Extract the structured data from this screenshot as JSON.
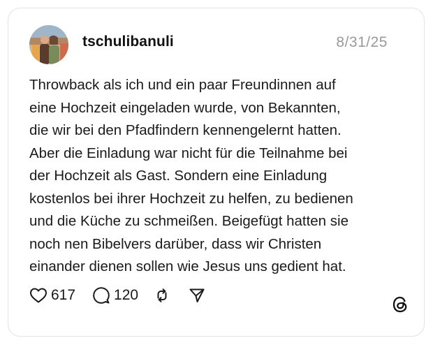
{
  "post": {
    "username": "tschulibanuli",
    "date": "8/31/25",
    "text_lines": [
      "Throwback als ich und ein paar Freundinnen auf",
      "eine Hochzeit eingeladen wurde, von Bekannten,",
      "die wir bei den Pfadfindern kennengelernt hatten.",
      "Aber die Einladung war nicht für die Teilnahme bei",
      "der Hochzeit als Gast. Sondern eine Einladung",
      "kostenlos bei ihrer Hochzeit zu helfen, zu bedienen",
      "und die Küche zu schmeißen. Beigefügt hatten sie",
      "noch nen Bibelvers darüber, dass wir Christen",
      "einander dienen sollen wie Jesus uns gedient hat."
    ]
  },
  "actions": {
    "like_count": "617",
    "reply_count": "120",
    "icons": [
      "heart-icon",
      "comment-icon",
      "repost-icon",
      "share-icon"
    ]
  },
  "brand": {
    "logo": "threads-logo-icon"
  }
}
